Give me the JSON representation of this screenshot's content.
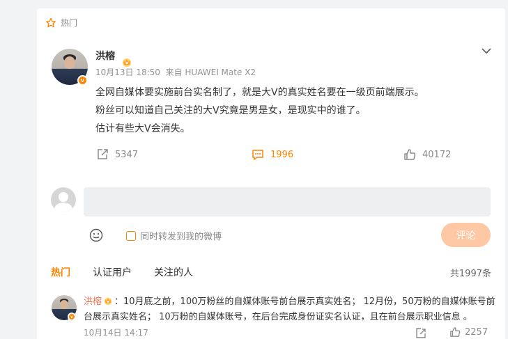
{
  "header": {
    "label": "热门",
    "icon": "star-outline-icon"
  },
  "post": {
    "author": "洪榕",
    "author_badge": "crown-icon",
    "verified_badge": "v",
    "date": "10月13日 18:50",
    "source": "来自 HUAWEI Mate X2",
    "content": [
      "全网自媒体要实施前台实名制了，就是大V的真实姓名要在一级页前端展示。",
      "粉丝可以知道自己关注的大V究竟是男是女，是现实中的谁了。",
      "估计有些大V会消失。"
    ],
    "repost_count": "5347",
    "comment_count": "1996",
    "like_count": "40172"
  },
  "composer": {
    "placeholder": "",
    "repost_label": "同时转发到我的微博",
    "submit_label": "评论"
  },
  "tabs": [
    "热门",
    "认证用户",
    "关注的人"
  ],
  "total_count": "共1997条",
  "top_comment": {
    "author": "洪榕",
    "text": "：10月底之前，100万粉丝的自媒体账号前台展示真实姓名； 12月份，50万粉的自媒体账号前台展示真实姓名； 10万粉的自媒体账号，在后台完成身份证实名认证，且在前台展示职业信息 。",
    "date": "10月14日 14:17",
    "like_count": "2257"
  },
  "colors": {
    "accent": "#ff8200",
    "name_link": "#eb7350",
    "submit_disabled": "#ffc8a5"
  }
}
